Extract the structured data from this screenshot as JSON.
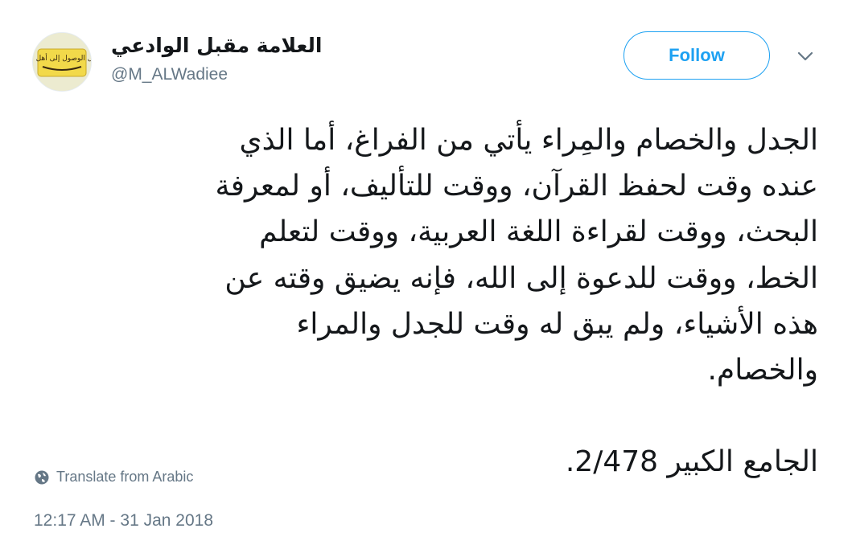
{
  "tweet": {
    "avatar_icon": "account-logo-avatar",
    "avatar_text": "تسهيل الوصول إلى أهل السنة",
    "display_name": "العلامة مقبل الوادعي",
    "handle": "@M_ALWadiee",
    "follow_label": "Follow",
    "caret_icon": "chevron-down-icon",
    "text_lines": [
      "الجدل والخصام والمِراء يأتي من الفراغ، أما الذي",
      "عنده وقت لحفظ القرآن، ووقت للتأليف، أو لمعرفة",
      "البحث، ووقت لقراءة اللغة العربية، ووقت لتعلم",
      "الخط، ووقت للدعوة إلى الله، فإنه يضيق وقته عن",
      "هذه الأشياء، ولم يبق له وقت للجدل والمراء",
      "والخصام.",
      "",
      "الجامع الكبير 2/478."
    ],
    "translate_icon": "globe-icon",
    "translate_label": "Translate from Arabic",
    "timestamp": "12:17 AM - 31 Jan 2018"
  },
  "colors": {
    "accent": "#1da1f2",
    "text": "#14171a",
    "secondary": "#657786"
  }
}
